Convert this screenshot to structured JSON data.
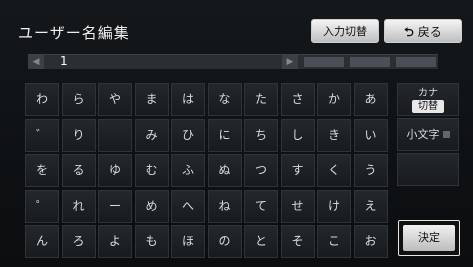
{
  "header": {
    "title": "ユーザー名編集",
    "switch_label": "入力切替",
    "back_label": "戻る"
  },
  "input": {
    "value": "1"
  },
  "keyboard": {
    "rows": [
      [
        "わ",
        "ら",
        "や",
        "ま",
        "は",
        "な",
        "た",
        "さ",
        "か",
        "あ"
      ],
      [
        "゛",
        "り",
        "",
        "み",
        "ひ",
        "に",
        "ち",
        "し",
        "き",
        "い"
      ],
      [
        "を",
        "る",
        "ゆ",
        "む",
        "ふ",
        "ぬ",
        "つ",
        "す",
        "く",
        "う"
      ],
      [
        "゜",
        "れ",
        "ー",
        "め",
        "へ",
        "ね",
        "て",
        "せ",
        "け",
        "え"
      ],
      [
        "ん",
        "ろ",
        "よ",
        "も",
        "ほ",
        "の",
        "と",
        "そ",
        "こ",
        "お"
      ]
    ]
  },
  "side": {
    "kana_label": "カナ",
    "kana_sub": "切替",
    "small_label": "小文字",
    "blank_label": "",
    "confirm_label": "決定"
  }
}
